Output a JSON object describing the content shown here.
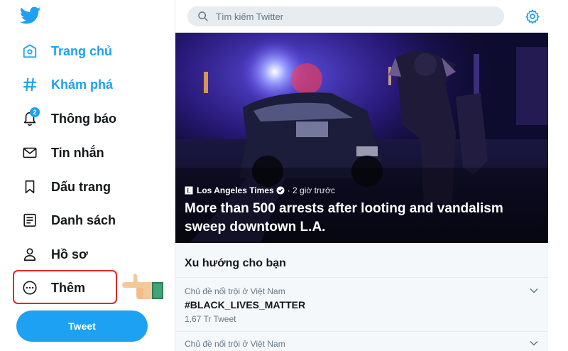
{
  "sidebar": {
    "logo_icon": "twitter-bird-icon",
    "items": [
      {
        "label": "Trang chủ",
        "icon": "home-icon",
        "active": true
      },
      {
        "label": "Khám phá",
        "icon": "hashtag-icon",
        "active": true
      },
      {
        "label": "Thông báo",
        "icon": "bell-icon",
        "badge": "2"
      },
      {
        "label": "Tin nhắn",
        "icon": "envelope-icon"
      },
      {
        "label": "Dấu trang",
        "icon": "bookmark-icon"
      },
      {
        "label": "Danh sách",
        "icon": "list-icon"
      },
      {
        "label": "Hồ sơ",
        "icon": "person-icon"
      },
      {
        "label": "Thêm",
        "icon": "more-circle-icon"
      }
    ],
    "tweet_button": "Tweet"
  },
  "search": {
    "placeholder": "Tìm kiếm Twitter"
  },
  "hero": {
    "source_name": "Los Angeles Times",
    "time": "· 2 giờ trước",
    "headline": "More than 500 arrests after looting and vandalism sweep downtown L.A."
  },
  "trends": {
    "title": "Xu hướng cho bạn",
    "items": [
      {
        "context": "Chủ đề nổi trội ở Việt Nam",
        "topic": "#BLACK_LIVES_MATTER",
        "count": "1,67 Tr Tweet"
      },
      {
        "context": "Chủ đề nổi trội ở Việt Nam"
      }
    ]
  },
  "colors": {
    "accent": "#1da1f2",
    "highlight": "#e0282c",
    "text": "#14171a",
    "muted": "#657786"
  }
}
